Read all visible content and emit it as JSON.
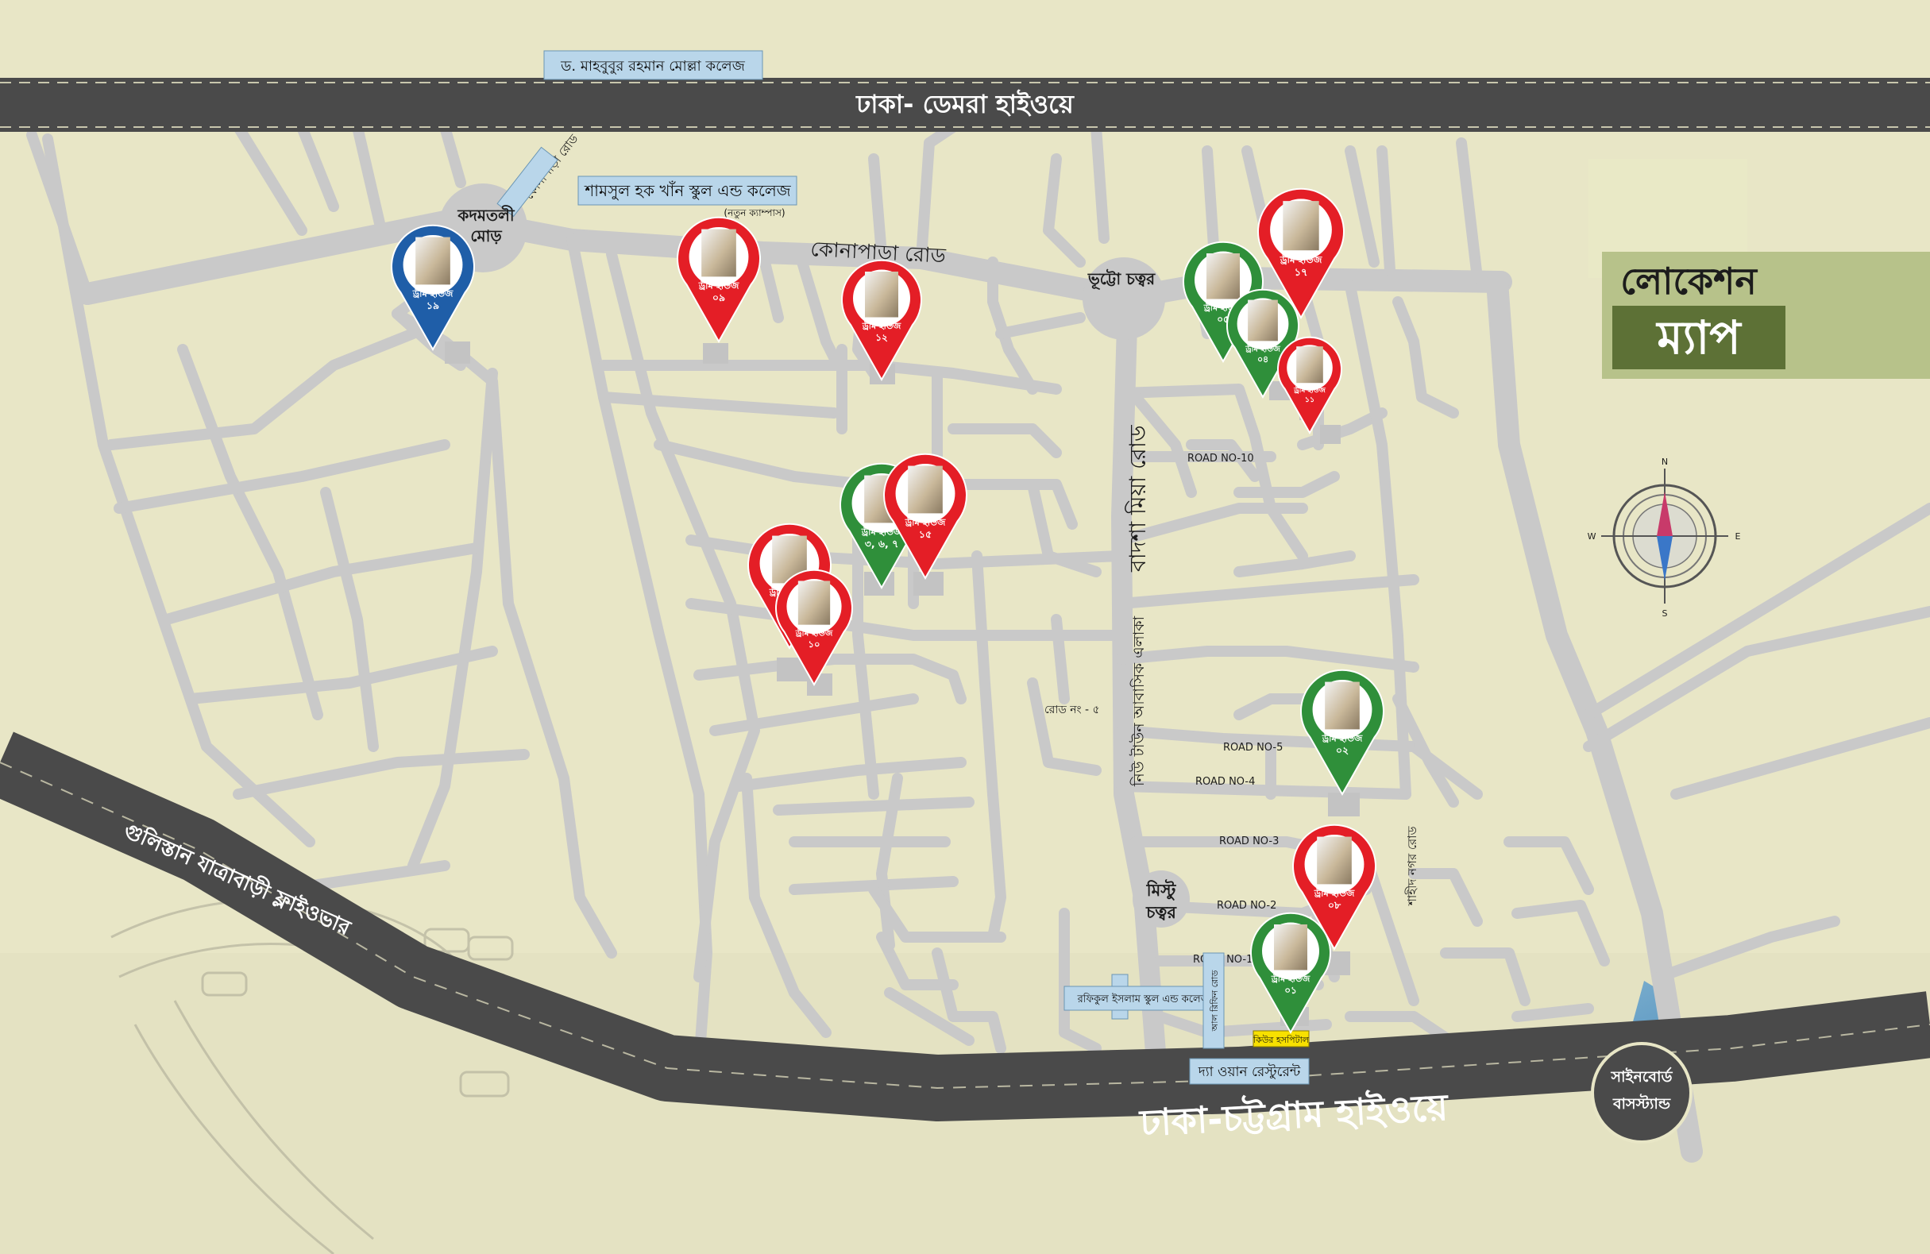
{
  "highways": {
    "top": "ঢাকা- ডেমরা হাইওয়ে",
    "bottom": "ঢাকা-চট্টগ্রাম হাইওয়ে",
    "flyover": "গুলিস্তান যাত্রাবাড়ী ফ্লাইওভার"
  },
  "roads": {
    "konapara": "কোনাপাড়া রোড",
    "konapara_small": "কোনাপাড়া রোড",
    "badsha_mia": "বাদশা মিয়া রোড",
    "residential": "নিউ টাউন আবাসিক এলাকা",
    "road_5_bn": "রোড নং - ৫",
    "road_no_10": "ROAD NO-10",
    "road_no_5": "ROAD NO-5",
    "road_no_4": "ROAD NO-4",
    "road_no_3": "ROAD NO-3",
    "road_no_2": "ROAD NO-2",
    "road_no_1": "ROAD NO-1",
    "right_road": "শাহীদ নগর রোড"
  },
  "landmarks": {
    "college_top": "ড. মাহবুবুর রহমান মোল্লা কলেজ",
    "school": "শামসুল হক খাঁন স্কুল এন্ড কলেজ",
    "school_sub": "(নতুন ক্যাম্পাস)",
    "kadamtali_1": "কদমতলী",
    "kadamtali_2": "মোড়",
    "bhutto": "ভূট্টো চত্বর",
    "mistu_1": "মিস্টু",
    "mistu_2": "চত্বর",
    "signboard_1": "সাইনবোর্ড",
    "signboard_2": "বাসস্ট্যান্ড",
    "rafiqul": "রফিকুল ইসলাম স্কুল এন্ড কলেজ",
    "the_one": "দ্যা ওয়ান রেস্টুরেন্ট",
    "hospital": "কিউর হসপিটাল",
    "hospital_road": "আল রিফিন রোড"
  },
  "title": {
    "line1": "লোকেশন",
    "line2": "ম্যাপ"
  },
  "compass": {
    "n": "N",
    "s": "S",
    "e": "E",
    "w": "W"
  },
  "pins": [
    {
      "label": "ড্রীম হাউজ",
      "num": "১৯",
      "color": "blue"
    },
    {
      "label": "ড্রীম হাউজ",
      "num": "০৯",
      "color": "red"
    },
    {
      "label": "ড্রীম হাউজ",
      "num": "১২",
      "color": "red"
    },
    {
      "label": "ড্রীম হাউজ",
      "num": "০৫",
      "color": "green"
    },
    {
      "label": "ড্রীম হাউজ",
      "num": "১৭",
      "color": "red"
    },
    {
      "label": "ড্রীম হাউজ",
      "num": "০৪",
      "color": "green"
    },
    {
      "label": "ড্রীম হাউজ",
      "num": "১১",
      "color": "red"
    },
    {
      "label": "ড্রীম হাউজ",
      "num": "৩, ৬, ৭",
      "color": "green"
    },
    {
      "label": "ড্রীম হাউজ",
      "num": "১৫",
      "color": "red"
    },
    {
      "label": "ড্রীম হাউজ",
      "num": "১৮",
      "color": "red"
    },
    {
      "label": "ড্রীম হাউজ",
      "num": "১০",
      "color": "red"
    },
    {
      "label": "ড্রীম হাউজ",
      "num": "০২",
      "color": "green"
    },
    {
      "label": "ড্রীম হাউজ",
      "num": "০৮",
      "color": "red"
    },
    {
      "label": "ড্রীম হাউজ",
      "num": "০১",
      "color": "green"
    }
  ],
  "colors": {
    "background": "#e8e6c6",
    "street": "#c9c9c9",
    "highway": "#4a4a4a",
    "title_dark": "#5d7136",
    "title_light": "#b7c28a",
    "pin_red": "#e41e26",
    "pin_green": "#2f8f3a",
    "pin_blue": "#1f5ea8"
  }
}
